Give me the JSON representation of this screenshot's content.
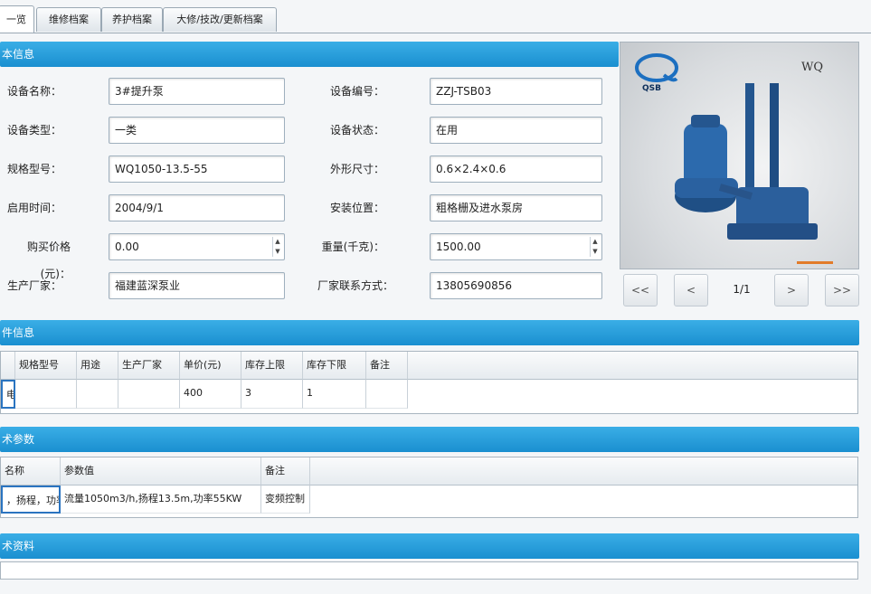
{
  "tabs": [
    {
      "label": "一览"
    },
    {
      "label": "维修档案"
    },
    {
      "label": "养护档案"
    },
    {
      "label": "大修/技改/更新档案"
    }
  ],
  "basic": {
    "title": "本信息",
    "left_labels": [
      "设备名称：",
      "设备类型：",
      "规格型号：",
      "启用时间：",
      "购买价格(元)：",
      "生产厂家："
    ],
    "left_values": [
      "3#提升泵",
      "一类",
      "WQ1050-13.5-55",
      "2004/9/1",
      "0.00",
      "福建蓝深泵业"
    ],
    "right_labels": [
      "设备编号：",
      "设备状态：",
      "外形尺寸：",
      "安装位置：",
      "重量(千克)：",
      "厂家联系方式："
    ],
    "right_values": [
      "ZZJ-TSB03",
      "在用",
      "0.6×2.4×0.6",
      "粗格栅及进水泵房",
      "1500.00",
      "13805690856"
    ]
  },
  "photo": {
    "logo_text": "QSB",
    "model_text": "WQ",
    "nav": {
      "first": "<<",
      "prev": "<",
      "page": "1/1",
      "next": ">",
      "last": ">>"
    }
  },
  "parts": {
    "title": "件信息",
    "columns": [
      "",
      "规格型号",
      "用途",
      "生产厂家",
      "单价(元)",
      "库存上限",
      "库存下限",
      "备注"
    ],
    "rows": [
      [
        "电机",
        "",
        "",
        "",
        "400",
        "3",
        "1",
        ""
      ]
    ]
  },
  "tech": {
    "title": "术参数",
    "columns": [
      "名称",
      "参数值",
      "备注"
    ],
    "rows": [
      [
        "，扬程，功率",
        "流量1050m3/h,扬程13.5m,功率55KW",
        "变频控制"
      ]
    ]
  },
  "docs": {
    "title": "术资料"
  }
}
